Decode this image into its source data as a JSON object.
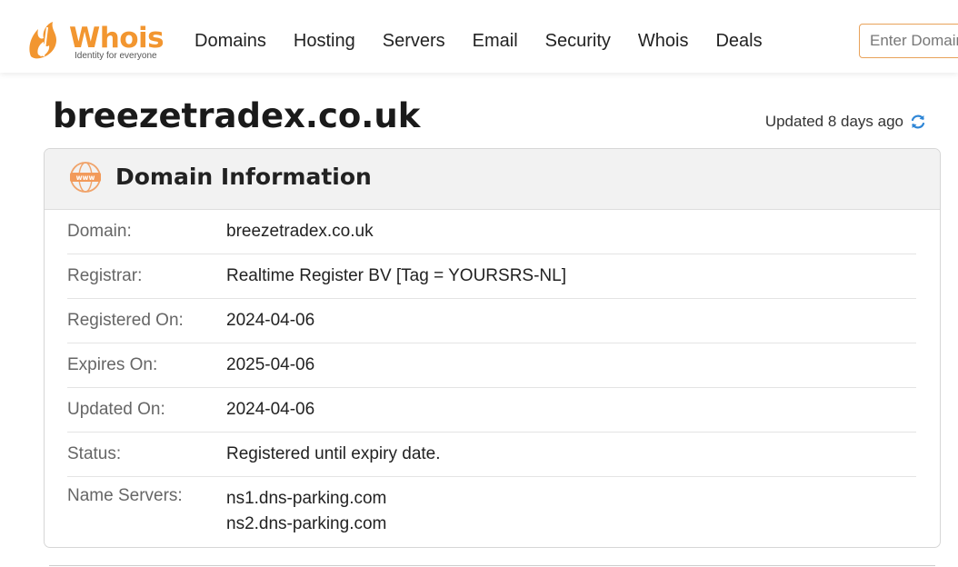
{
  "brand": {
    "name": "Whois",
    "tagline": "Identity for everyone",
    "accent_color": "#f29630"
  },
  "nav": {
    "items": [
      "Domains",
      "Hosting",
      "Servers",
      "Email",
      "Security",
      "Whois",
      "Deals"
    ]
  },
  "search": {
    "placeholder": "Enter Domain or IP"
  },
  "page": {
    "title": "breezetradex.co.uk",
    "updated_text": "Updated 8 days ago",
    "refresh_icon": "refresh-icon"
  },
  "card": {
    "icon": "www-globe-icon",
    "title": "Domain Information",
    "rows": [
      {
        "label": "Domain:",
        "value": "breezetradex.co.uk"
      },
      {
        "label": "Registrar:",
        "value": "Realtime Register BV [Tag = YOURSRS-NL]"
      },
      {
        "label": "Registered On:",
        "value": "2024-04-06"
      },
      {
        "label": "Expires On:",
        "value": "2025-04-06"
      },
      {
        "label": "Updated On:",
        "value": "2024-04-06"
      },
      {
        "label": "Status:",
        "value": "Registered until expiry date."
      }
    ],
    "name_servers": {
      "label": "Name Servers:",
      "values": [
        "ns1.dns-parking.com",
        "ns2.dns-parking.com"
      ]
    }
  }
}
